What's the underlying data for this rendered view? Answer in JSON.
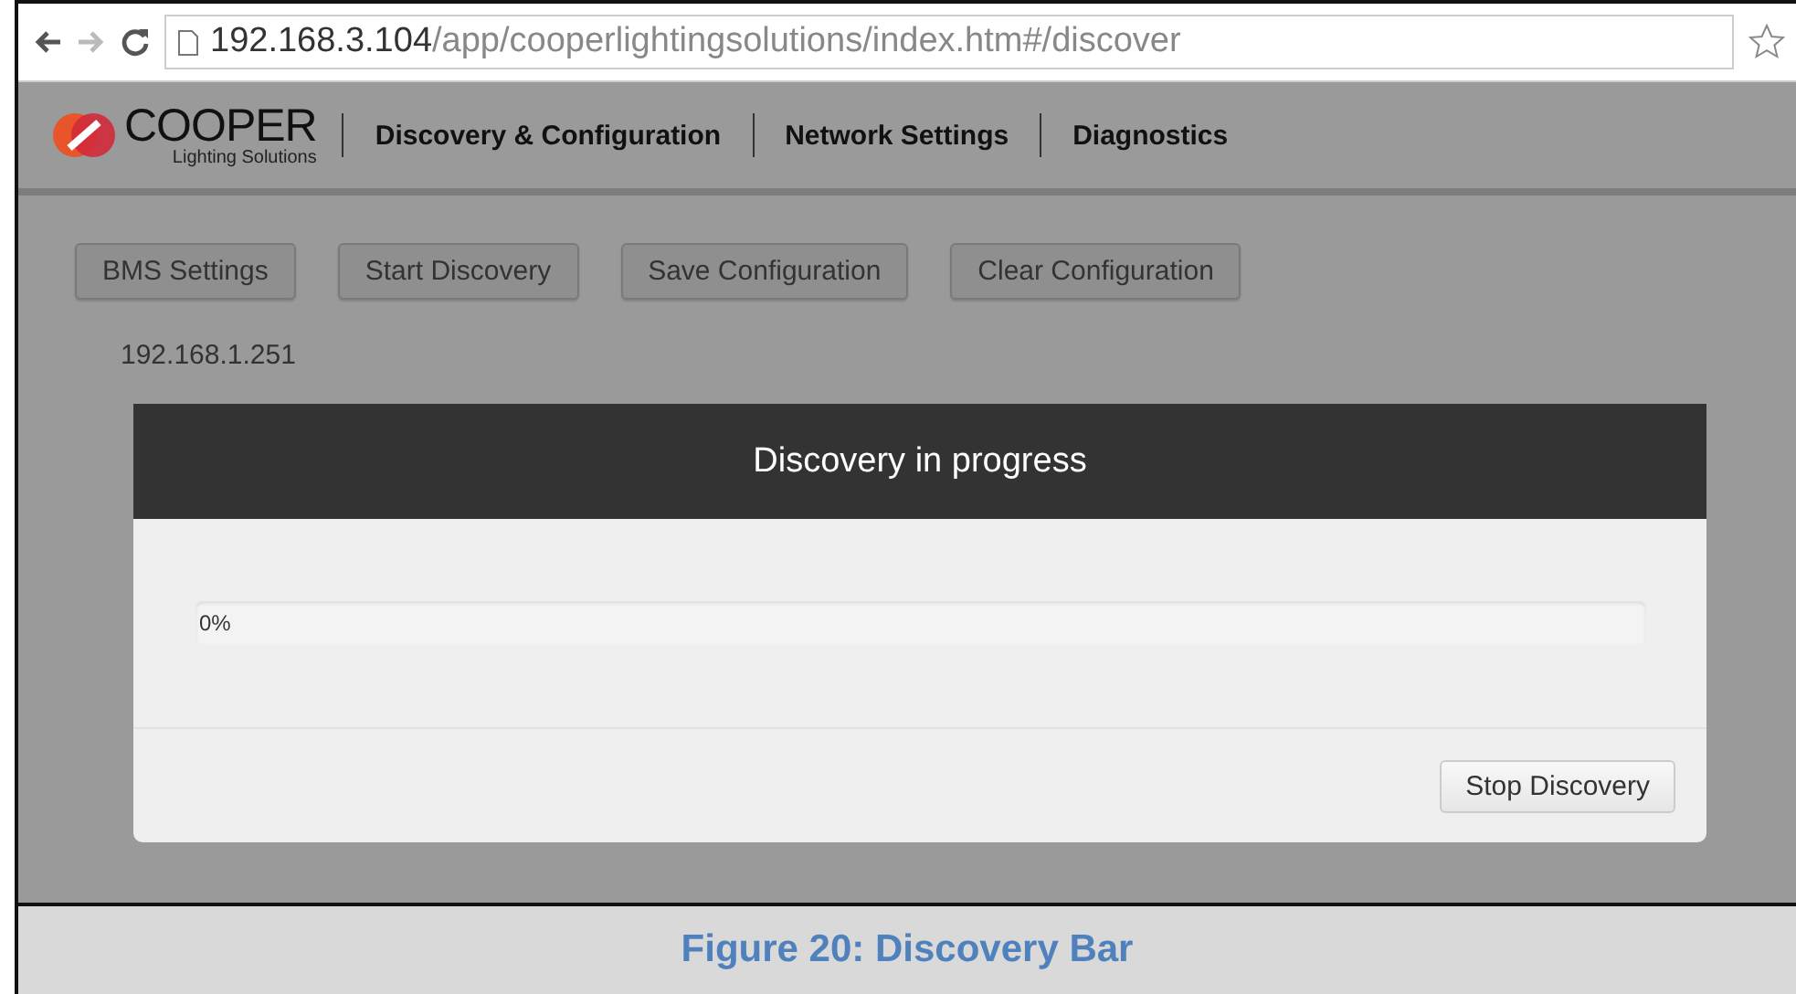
{
  "browser": {
    "url_host": "192.168.3.104",
    "url_path": "/app/cooperlightingsolutions/index.htm#/discover"
  },
  "logo": {
    "name": "COOPER",
    "tagline": "Lighting Solutions"
  },
  "nav": [
    {
      "label": "Discovery & Configuration"
    },
    {
      "label": "Network Settings"
    },
    {
      "label": "Diagnostics"
    }
  ],
  "toolbar": [
    "BMS Settings",
    "Start Discovery",
    "Save Configuration",
    "Clear Configuration"
  ],
  "ip_address": "192.168.1.251",
  "modal": {
    "title": "Discovery in progress",
    "progress": {
      "level": 0,
      "reading": "0%"
    },
    "button": "Stop Discovery"
  },
  "caption": "Figure 20: Discovery Bar"
}
